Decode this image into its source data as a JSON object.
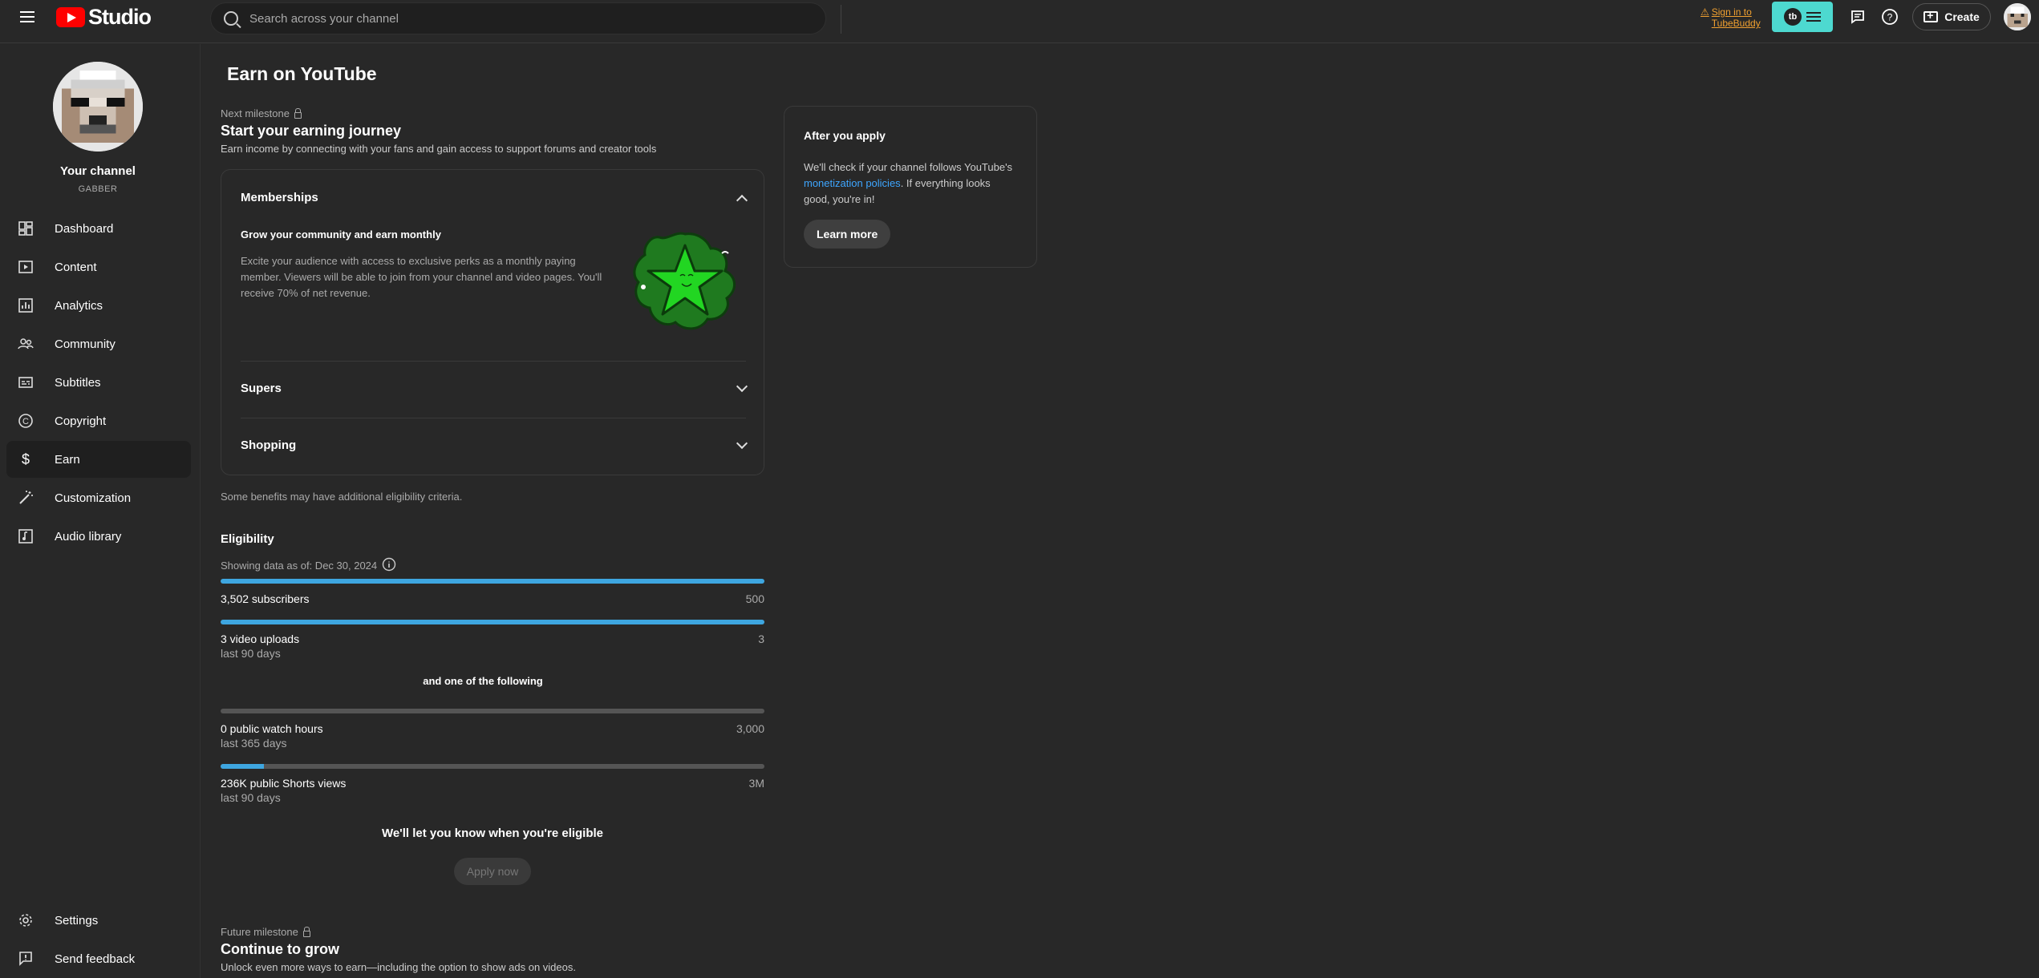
{
  "topbar": {
    "logo_text": "Studio",
    "search_placeholder": "Search across your channel",
    "tubebuddy_line1": "Sign in to",
    "tubebuddy_line2": "TubeBuddy",
    "tubebuddy_logo": "tb",
    "create_label": "Create"
  },
  "sidebar": {
    "channel_name": "Your channel",
    "channel_handle": "GABBER",
    "items": [
      {
        "label": "Dashboard",
        "icon": "dashboard-icon"
      },
      {
        "label": "Content",
        "icon": "content-icon"
      },
      {
        "label": "Analytics",
        "icon": "analytics-icon"
      },
      {
        "label": "Community",
        "icon": "community-icon"
      },
      {
        "label": "Subtitles",
        "icon": "subtitles-icon"
      },
      {
        "label": "Copyright",
        "icon": "copyright-icon"
      },
      {
        "label": "Earn",
        "icon": "dollar-icon",
        "active": true
      },
      {
        "label": "Customization",
        "icon": "wand-icon"
      },
      {
        "label": "Audio library",
        "icon": "audio-library-icon"
      }
    ],
    "bottom": [
      {
        "label": "Settings",
        "icon": "gear-icon"
      },
      {
        "label": "Send feedback",
        "icon": "feedback-icon"
      }
    ]
  },
  "main": {
    "title": "Earn on YouTube",
    "next_milestone_label": "Next milestone",
    "journey_title": "Start your earning journey",
    "journey_desc": "Earn income by connecting with your fans and gain access to support forums and creator tools",
    "memberships": {
      "title": "Memberships",
      "subtitle": "Grow your community and earn monthly",
      "desc_lines": [
        "Excite your audience with access to exclusive perks as a monthly paying",
        "member. Viewers will be able to join from your channel and video pages. You'll",
        "receive 70% of net revenue."
      ]
    },
    "supers_title": "Supers",
    "shopping_title": "Shopping",
    "benefits_note": "Some benefits may have additional eligibility criteria.",
    "eligibility_title": "Eligibility",
    "data_as_of": "Showing data as of: Dec 30, 2024",
    "metrics": [
      {
        "label": "3,502 subscribers",
        "target": "500",
        "sub": "",
        "progress": 1.0
      },
      {
        "label": "3 video uploads",
        "target": "3",
        "sub": "last 90 days",
        "progress": 1.0
      },
      {
        "label": "0 public watch hours",
        "target": "3,000",
        "sub": "last 365 days",
        "progress": 0.0
      },
      {
        "label": "236K public Shorts views",
        "target": "3M",
        "sub": "last 90 days",
        "progress": 0.08
      }
    ],
    "one_of_following": "and one of the following",
    "eligible_notice": "We'll let you know when you're eligible",
    "apply_label": "Apply now",
    "future_milestone_label": "Future milestone",
    "future_title": "Continue to grow",
    "future_desc": "Unlock even more ways to earn—including the option to show ads on videos."
  },
  "apply_card": {
    "title": "After you apply",
    "text1": "We'll check if your channel follows YouTube's",
    "link": "monetization policies",
    "text2": ". If everything looks",
    "text3": "good, you're in!",
    "learn_more": "Learn more"
  },
  "colors": {
    "background": "#282828",
    "progress_fill": "#3ea6e0",
    "accent_red": "#ff0000",
    "tubebuddy": "#4dd9d0",
    "link": "#3ea6ff"
  }
}
